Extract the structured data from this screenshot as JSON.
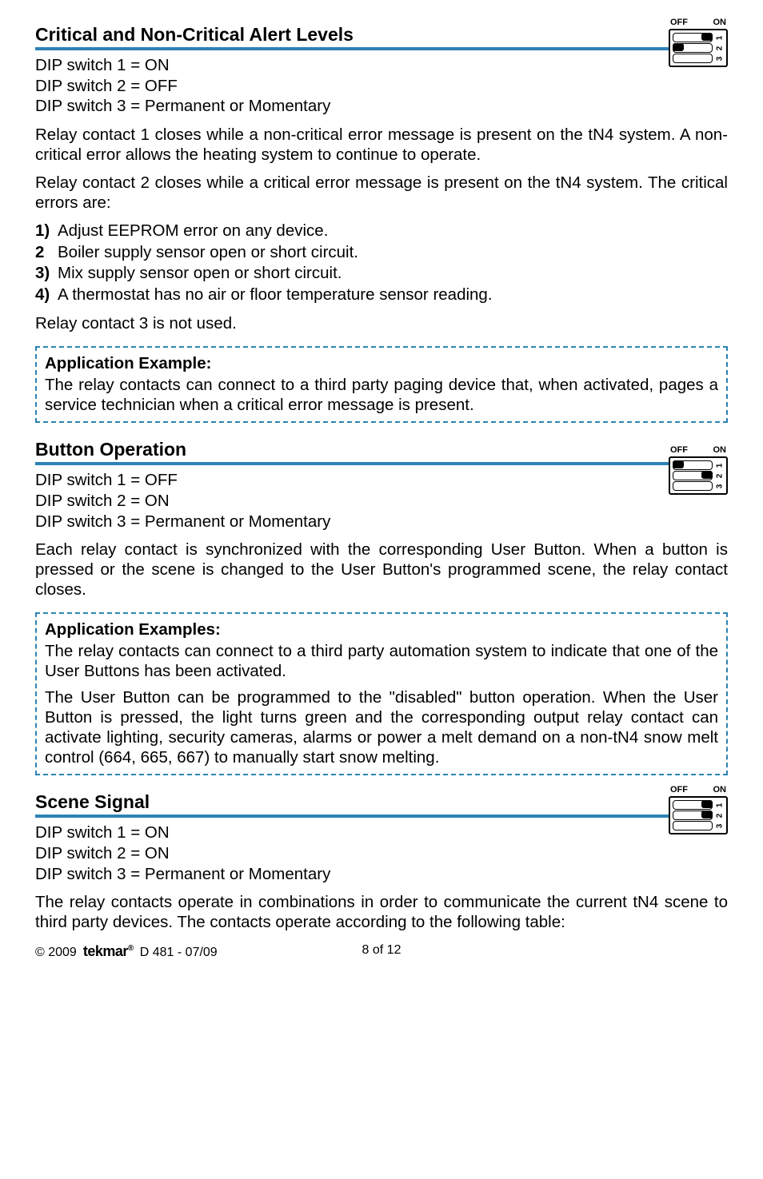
{
  "sections": {
    "critical": {
      "title": "Critical and Non-Critical Alert Levels",
      "dip_off": "OFF",
      "dip_on": "ON",
      "dip1": "DIP switch 1 = ON",
      "dip2": "DIP switch 2 = OFF",
      "dip3": "DIP switch 3 = Permanent or Momentary",
      "p1": "Relay contact 1 closes while a non-critical error message is present on the tN4 system. A non-critical error allows the heating system to continue to operate.",
      "p2": "Relay contact 2 closes while a critical error message is present on the tN4 system. The critical errors are:",
      "list": [
        {
          "n": "1)",
          "t": "Adjust EEPROM error on any device."
        },
        {
          "n": "2",
          "t": "Boiler supply sensor open or short circuit."
        },
        {
          "n": "3)",
          "t": "Mix supply sensor open or short circuit."
        },
        {
          "n": "4)",
          "t": "A thermostat has no air or floor temperature sensor reading."
        }
      ],
      "p3": "Relay contact 3 is not used.",
      "callout_title": "Application Example:",
      "callout_text": "The relay contacts can connect to a third party paging device that, when activated, pages a service technician when a critical error message is present."
    },
    "button": {
      "title": "Button Operation",
      "dip_off": "OFF",
      "dip_on": "ON",
      "dip1": "DIP switch 1 = OFF",
      "dip2": "DIP switch 2 = ON",
      "dip3": "DIP switch 3 = Permanent or Momentary",
      "p1": "Each relay contact is synchronized with the corresponding User Button. When a button is pressed or the scene is changed to the User Button's programmed scene, the relay contact closes.",
      "callout_title": "Application Examples:",
      "callout_p1": "The relay contacts can connect to a third party automation system to indicate that one of the User Buttons has been activated.",
      "callout_p2": "The User Button can be programmed to the \"disabled\" button operation. When the User Button is pressed, the light turns green and the corresponding output relay contact can activate lighting, security cameras, alarms or power a melt demand on a non-tN4 snow melt control (664, 665, 667) to manually start snow melting."
    },
    "scene": {
      "title": "Scene Signal",
      "dip_off": "OFF",
      "dip_on": "ON",
      "dip1": "DIP switch 1 = ON",
      "dip2": "DIP switch 2 = ON",
      "dip3": "DIP switch 3 = Permanent or Momentary",
      "p1": "The relay contacts operate in combinations in order to communicate the current tN4 scene to third party devices. The contacts operate according to the following table:"
    }
  },
  "footer": {
    "copyright": "© 2009",
    "brand": "tekmar",
    "reg": "®",
    "doc": "D 481 - 07/09",
    "page": "8 of 12"
  }
}
